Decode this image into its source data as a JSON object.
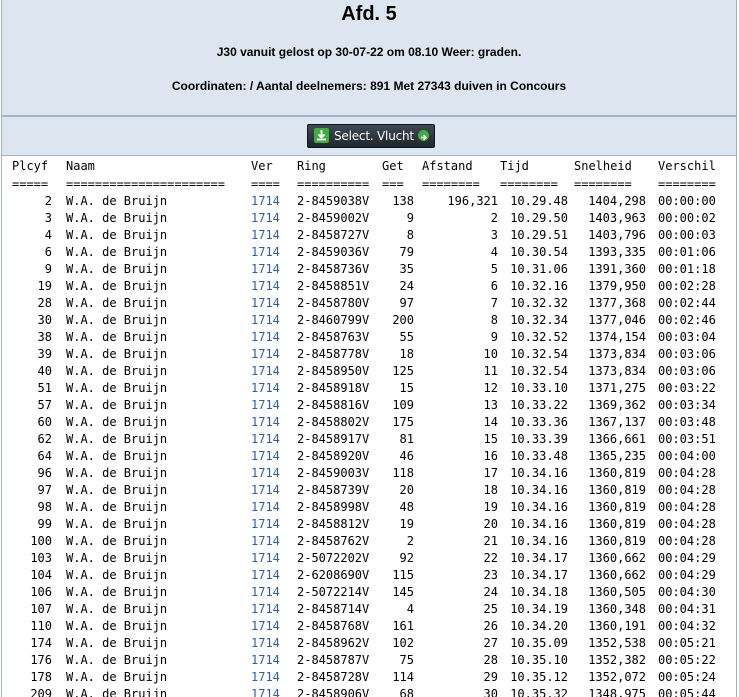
{
  "header": {
    "title": "Afd. 5",
    "subtitle": "J30 vanuit gelost op 30-07-22 om 08.10 Weer: graden.",
    "coords": "Coordinaten: / Aantal deelnemers: 891 Met 27343 duiven in Concours"
  },
  "toolbar": {
    "select_label": "Select. Vlucht",
    "icon": "download-icon",
    "arrow_icon": "arrow-right-icon"
  },
  "table": {
    "columns": [
      "Plcyf",
      "Naam",
      "Ver",
      "Ring",
      "Get",
      "Afstand",
      "Tijd",
      "Snelheid",
      "Verschil"
    ],
    "underline": [
      "=====",
      "======================",
      "====",
      "==========",
      "===",
      "========",
      "========",
      "========",
      "========"
    ],
    "rows": [
      [
        "2",
        "W.A. de Bruijn",
        "1714",
        "2-8459038V",
        "138",
        "196,321",
        "10.29.48",
        "1404,298",
        "00:00:00"
      ],
      [
        "3",
        "W.A. de Bruijn",
        "1714",
        "2-8459002V",
        "9",
        "2",
        "10.29.50",
        "1403,963",
        "00:00:02"
      ],
      [
        "4",
        "W.A. de Bruijn",
        "1714",
        "2-8458727V",
        "8",
        "3",
        "10.29.51",
        "1403,796",
        "00:00:03"
      ],
      [
        "6",
        "W.A. de Bruijn",
        "1714",
        "2-8459036V",
        "79",
        "4",
        "10.30.54",
        "1393,335",
        "00:01:06"
      ],
      [
        "9",
        "W.A. de Bruijn",
        "1714",
        "2-8458736V",
        "35",
        "5",
        "10.31.06",
        "1391,360",
        "00:01:18"
      ],
      [
        "19",
        "W.A. de Bruijn",
        "1714",
        "2-8458851V",
        "24",
        "6",
        "10.32.16",
        "1379,950",
        "00:02:28"
      ],
      [
        "28",
        "W.A. de Bruijn",
        "1714",
        "2-8458780V",
        "97",
        "7",
        "10.32.32",
        "1377,368",
        "00:02:44"
      ],
      [
        "30",
        "W.A. de Bruijn",
        "1714",
        "2-8460799V",
        "200",
        "8",
        "10.32.34",
        "1377,046",
        "00:02:46"
      ],
      [
        "38",
        "W.A. de Bruijn",
        "1714",
        "2-8458763V",
        "55",
        "9",
        "10.32.52",
        "1374,154",
        "00:03:04"
      ],
      [
        "39",
        "W.A. de Bruijn",
        "1714",
        "2-8458778V",
        "18",
        "10",
        "10.32.54",
        "1373,834",
        "00:03:06"
      ],
      [
        "40",
        "W.A. de Bruijn",
        "1714",
        "2-8458950V",
        "125",
        "11",
        "10.32.54",
        "1373,834",
        "00:03:06"
      ],
      [
        "51",
        "W.A. de Bruijn",
        "1714",
        "2-8458918V",
        "15",
        "12",
        "10.33.10",
        "1371,275",
        "00:03:22"
      ],
      [
        "57",
        "W.A. de Bruijn",
        "1714",
        "2-8458816V",
        "109",
        "13",
        "10.33.22",
        "1369,362",
        "00:03:34"
      ],
      [
        "60",
        "W.A. de Bruijn",
        "1714",
        "2-8458802V",
        "175",
        "14",
        "10.33.36",
        "1367,137",
        "00:03:48"
      ],
      [
        "62",
        "W.A. de Bruijn",
        "1714",
        "2-8458917V",
        "81",
        "15",
        "10.33.39",
        "1366,661",
        "00:03:51"
      ],
      [
        "64",
        "W.A. de Bruijn",
        "1714",
        "2-8458920V",
        "46",
        "16",
        "10.33.48",
        "1365,235",
        "00:04:00"
      ],
      [
        "96",
        "W.A. de Bruijn",
        "1714",
        "2-8459003V",
        "118",
        "17",
        "10.34.16",
        "1360,819",
        "00:04:28"
      ],
      [
        "97",
        "W.A. de Bruijn",
        "1714",
        "2-8458739V",
        "20",
        "18",
        "10.34.16",
        "1360,819",
        "00:04:28"
      ],
      [
        "98",
        "W.A. de Bruijn",
        "1714",
        "2-8458998V",
        "48",
        "19",
        "10.34.16",
        "1360,819",
        "00:04:28"
      ],
      [
        "99",
        "W.A. de Bruijn",
        "1714",
        "2-8458812V",
        "19",
        "20",
        "10.34.16",
        "1360,819",
        "00:04:28"
      ],
      [
        "100",
        "W.A. de Bruijn",
        "1714",
        "2-8458762V",
        "2",
        "21",
        "10.34.16",
        "1360,819",
        "00:04:28"
      ],
      [
        "103",
        "W.A. de Bruijn",
        "1714",
        "2-5072202V",
        "92",
        "22",
        "10.34.17",
        "1360,662",
        "00:04:29"
      ],
      [
        "104",
        "W.A. de Bruijn",
        "1714",
        "2-6208690V",
        "115",
        "23",
        "10.34.17",
        "1360,662",
        "00:04:29"
      ],
      [
        "106",
        "W.A. de Bruijn",
        "1714",
        "2-5072214V",
        "145",
        "24",
        "10.34.18",
        "1360,505",
        "00:04:30"
      ],
      [
        "107",
        "W.A. de Bruijn",
        "1714",
        "2-8458714V",
        "4",
        "25",
        "10.34.19",
        "1360,348",
        "00:04:31"
      ],
      [
        "110",
        "W.A. de Bruijn",
        "1714",
        "2-8458768V",
        "161",
        "26",
        "10.34.20",
        "1360,191",
        "00:04:32"
      ],
      [
        "174",
        "W.A. de Bruijn",
        "1714",
        "2-8458962V",
        "102",
        "27",
        "10.35.09",
        "1352,538",
        "00:05:21"
      ],
      [
        "176",
        "W.A. de Bruijn",
        "1714",
        "2-8458787V",
        "75",
        "28",
        "10.35.10",
        "1352,382",
        "00:05:22"
      ],
      [
        "178",
        "W.A. de Bruijn",
        "1714",
        "2-8458728V",
        "114",
        "29",
        "10.35.12",
        "1352,072",
        "00:05:24"
      ],
      [
        "209",
        "W.A. de Bruijn",
        "1714",
        "2-8458906V",
        "68",
        "30",
        "10.35.32",
        "1348,975",
        "00:05:44"
      ]
    ]
  }
}
